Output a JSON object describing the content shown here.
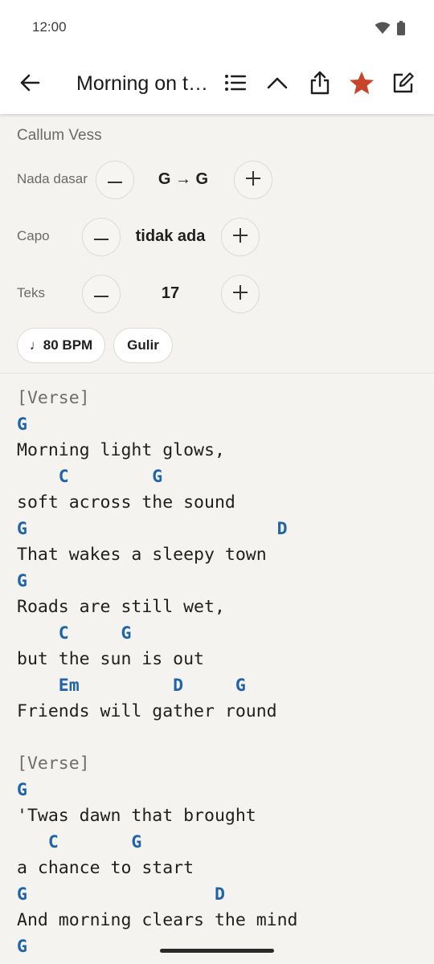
{
  "status_bar": {
    "time": "12:00"
  },
  "app_bar": {
    "title": "Morning on the Hill",
    "icons": [
      "back-arrow-icon",
      "list-icon",
      "chevron-up-icon",
      "share-icon",
      "star-icon",
      "edit-icon"
    ],
    "star_color": "#c8452b"
  },
  "settings": {
    "artist": "Callum Vess",
    "key": {
      "label": "Nada dasar",
      "value": "G → G"
    },
    "capo": {
      "label": "Capo",
      "value": "tidak ada"
    },
    "text_size": {
      "label": "Teks",
      "value": "17"
    },
    "chips": {
      "bpm": "♩80 BPM",
      "scroll": "Gulir"
    }
  },
  "colors": {
    "chord": "#1f63a8",
    "background": "#f4f3ef"
  },
  "song": {
    "lines": [
      {
        "type": "sec",
        "text": "[Verse]"
      },
      {
        "type": "chord",
        "text": "G"
      },
      {
        "type": "lyric",
        "text": "Morning light glows,"
      },
      {
        "type": "chord",
        "text": "    C        G"
      },
      {
        "type": "lyric",
        "text": "soft across the sound"
      },
      {
        "type": "chord",
        "text": "G                        D"
      },
      {
        "type": "lyric",
        "text": "That wakes a sleepy town"
      },
      {
        "type": "chord",
        "text": "G"
      },
      {
        "type": "lyric",
        "text": "Roads are still wet,"
      },
      {
        "type": "chord",
        "text": "    C     G"
      },
      {
        "type": "lyric",
        "text": "but the sun is out"
      },
      {
        "type": "chord",
        "text": "    Em         D     G"
      },
      {
        "type": "lyric",
        "text": "Friends will gather round"
      },
      {
        "type": "blank",
        "text": ""
      },
      {
        "type": "sec",
        "text": "[Verse]"
      },
      {
        "type": "chord",
        "text": "G"
      },
      {
        "type": "lyric",
        "text": "'Twas dawn that brought"
      },
      {
        "type": "chord",
        "text": "   C       G"
      },
      {
        "type": "lyric",
        "text": "a chance to start"
      },
      {
        "type": "chord",
        "text": "G                  D"
      },
      {
        "type": "lyric",
        "text": "And morning clears the mind"
      },
      {
        "type": "chord",
        "text": "G"
      }
    ]
  }
}
